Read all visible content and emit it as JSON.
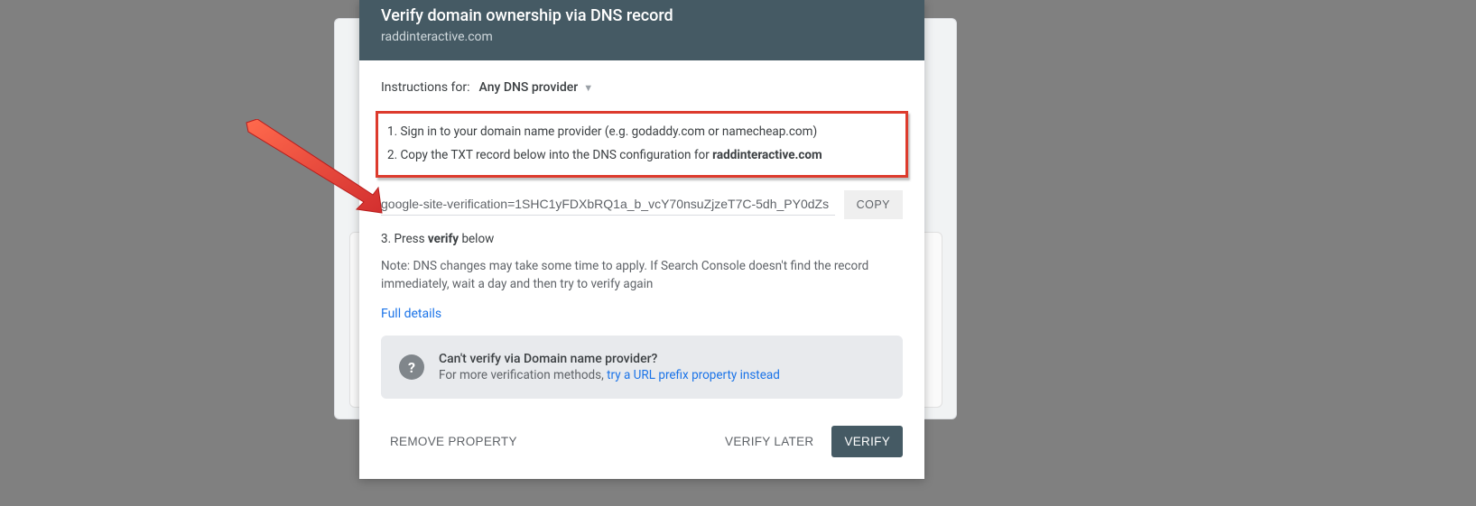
{
  "header": {
    "title": "Verify domain ownership via DNS record",
    "subtitle": "raddinteractive.com"
  },
  "instructions": {
    "label": "Instructions for:",
    "provider": "Any DNS provider"
  },
  "steps": {
    "one": "1. Sign in to your domain name provider (e.g. godaddy.com or namecheap.com)",
    "two_prefix": "2. Copy the TXT record below into the DNS configuration for ",
    "two_domain": "raddinteractive.com",
    "three_prefix": "3. Press ",
    "three_bold": "verify",
    "three_suffix": " below"
  },
  "txt": {
    "value": "google-site-verification=1SHC1yFDXbRQ1a_b_vcY70nsuZjzeT7C-5dh_PY0dZs",
    "copy_label": "COPY"
  },
  "note": "Note: DNS changes may take some time to apply. If Search Console doesn't find the record immediately, wait a day and then try to verify again",
  "links": {
    "full_details": "Full details"
  },
  "hint": {
    "title": "Can't verify via Domain name provider?",
    "text_prefix": "For more verification methods, ",
    "link": "try a URL prefix property instead"
  },
  "footer": {
    "remove": "REMOVE PROPERTY",
    "later": "VERIFY LATER",
    "verify": "VERIFY"
  }
}
